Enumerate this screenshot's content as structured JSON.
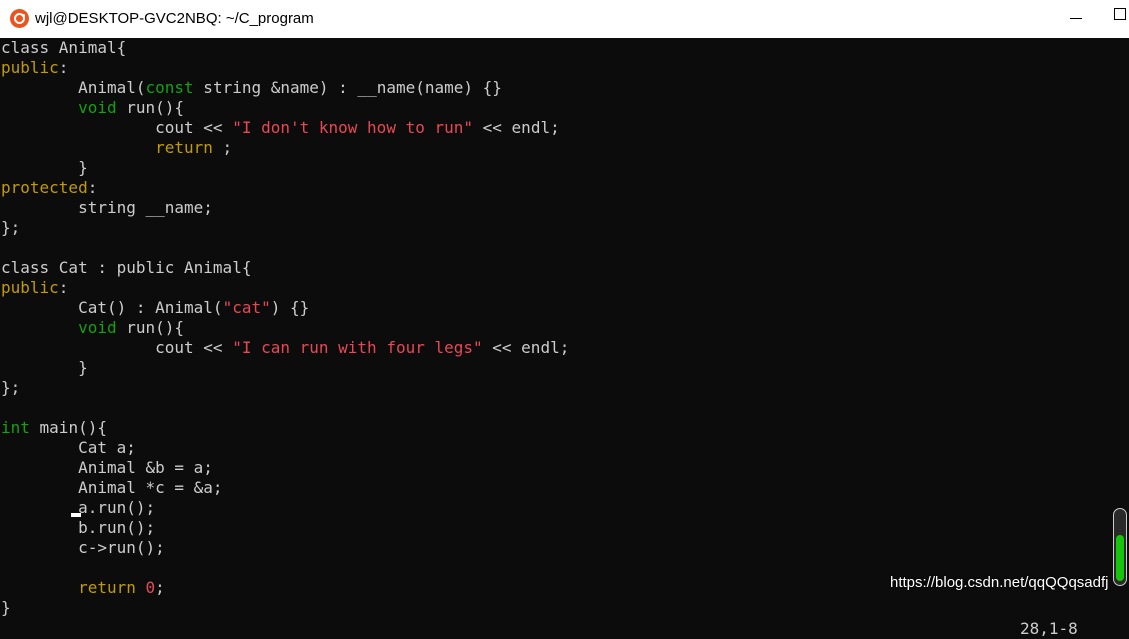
{
  "window": {
    "title": "wjl@DESKTOP-GVC2NBQ: ~/C_program",
    "icon": "ubuntu-icon"
  },
  "code_lines": [
    [
      {
        "t": "class Animal{",
        "c": ""
      }
    ],
    [
      {
        "t": "public",
        "c": "acc"
      },
      {
        "t": ":",
        "c": ""
      }
    ],
    [
      {
        "t": "        Animal(",
        "c": ""
      },
      {
        "t": "const",
        "c": "kw"
      },
      {
        "t": " string &name) : __name(name) {}",
        "c": ""
      }
    ],
    [
      {
        "t": "        ",
        "c": ""
      },
      {
        "t": "void",
        "c": "kw"
      },
      {
        "t": " run(){",
        "c": ""
      }
    ],
    [
      {
        "t": "                cout << ",
        "c": ""
      },
      {
        "t": "\"I don't know how to run\"",
        "c": "str"
      },
      {
        "t": " << endl;",
        "c": ""
      }
    ],
    [
      {
        "t": "                ",
        "c": ""
      },
      {
        "t": "return",
        "c": "ret"
      },
      {
        "t": " ;",
        "c": ""
      }
    ],
    [
      {
        "t": "        }",
        "c": ""
      }
    ],
    [
      {
        "t": "protected",
        "c": "acc"
      },
      {
        "t": ":",
        "c": ""
      }
    ],
    [
      {
        "t": "        string __name;",
        "c": ""
      }
    ],
    [
      {
        "t": "};",
        "c": ""
      }
    ],
    [
      {
        "t": "",
        "c": ""
      }
    ],
    [
      {
        "t": "class Cat : public Animal{",
        "c": ""
      }
    ],
    [
      {
        "t": "public",
        "c": "acc"
      },
      {
        "t": ":",
        "c": ""
      }
    ],
    [
      {
        "t": "        Cat() : Animal(",
        "c": ""
      },
      {
        "t": "\"cat\"",
        "c": "str"
      },
      {
        "t": ") {}",
        "c": ""
      }
    ],
    [
      {
        "t": "        ",
        "c": ""
      },
      {
        "t": "void",
        "c": "kw"
      },
      {
        "t": " run(){",
        "c": ""
      }
    ],
    [
      {
        "t": "                cout << ",
        "c": ""
      },
      {
        "t": "\"I can run with four legs\"",
        "c": "str"
      },
      {
        "t": " << endl;",
        "c": ""
      }
    ],
    [
      {
        "t": "        }",
        "c": ""
      }
    ],
    [
      {
        "t": "};",
        "c": ""
      }
    ],
    [
      {
        "t": "",
        "c": ""
      }
    ],
    [
      {
        "t": "int",
        "c": "kw"
      },
      {
        "t": " main(){",
        "c": ""
      }
    ],
    [
      {
        "t": "        Cat a;",
        "c": ""
      }
    ],
    [
      {
        "t": "        Animal &b = a;",
        "c": ""
      }
    ],
    [
      {
        "t": "        Animal *c = &a;",
        "c": ""
      }
    ],
    [
      {
        "t": "        a.run();",
        "c": ""
      }
    ],
    [
      {
        "t": "        b.run();",
        "c": ""
      }
    ],
    [
      {
        "t": "        c->run();",
        "c": ""
      }
    ],
    [
      {
        "t": "",
        "c": ""
      }
    ],
    [
      {
        "t": "        ",
        "c": ""
      },
      {
        "t": "return",
        "c": "ret"
      },
      {
        "t": " ",
        "c": ""
      },
      {
        "t": "0",
        "c": "num"
      },
      {
        "t": ";",
        "c": ""
      }
    ],
    [
      {
        "t": "}",
        "c": ""
      }
    ]
  ],
  "status": {
    "cursor_position": "28,1-8"
  },
  "watermark": "https://blog.csdn.net/qqQQqsadfj",
  "colors": {
    "background": "#0c0c0c",
    "text": "#cccccc",
    "keyword": "#13a10e",
    "access_specifier": "#c19c00",
    "string": "#e74856",
    "scroll_thumb": "#16c60c"
  }
}
